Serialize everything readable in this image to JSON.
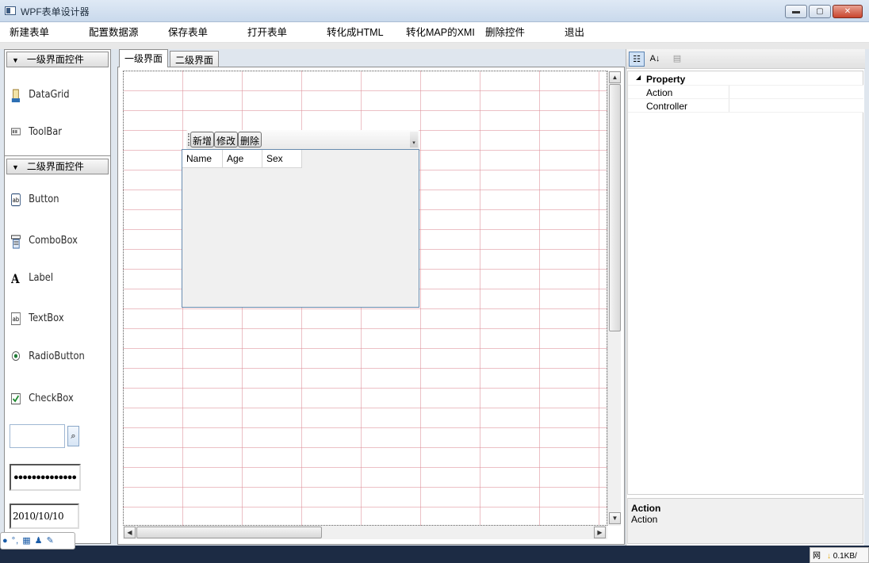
{
  "window": {
    "title": "WPF表单设计器",
    "min": "▬",
    "max": "▢",
    "close": "✕"
  },
  "menu": [
    "新建表单",
    "配置数据源",
    "保存表单",
    "打开表单",
    "转化成HTML",
    "转化MAP的XMI",
    "删除控件",
    "退出"
  ],
  "toolbox": {
    "group1": {
      "label": "一级界面控件",
      "items": [
        "DataGrid",
        "ToolBar"
      ]
    },
    "group2": {
      "label": "二级界面控件",
      "items": [
        "Button",
        "ComboBox",
        "Label",
        "TextBox",
        "RadioButton",
        "CheckBox"
      ]
    },
    "password_value": "●●●●●●●●●●●●●●",
    "date_value": "2010/10/10"
  },
  "tabs": [
    "一级界面",
    "二级界面"
  ],
  "canvas_widget": {
    "toolbar_buttons": [
      "新增",
      "修改",
      "删除"
    ],
    "columns": [
      "Name",
      "Age",
      "Sex"
    ]
  },
  "property_grid": {
    "category": "Property",
    "rows": [
      "Action",
      "Controller"
    ],
    "description": {
      "title": "Action",
      "text": "Action"
    }
  },
  "tray": {
    "label": "● °, ▦ ♟ ✎"
  },
  "network": {
    "label": "网",
    "rate": "0.1KB/"
  }
}
